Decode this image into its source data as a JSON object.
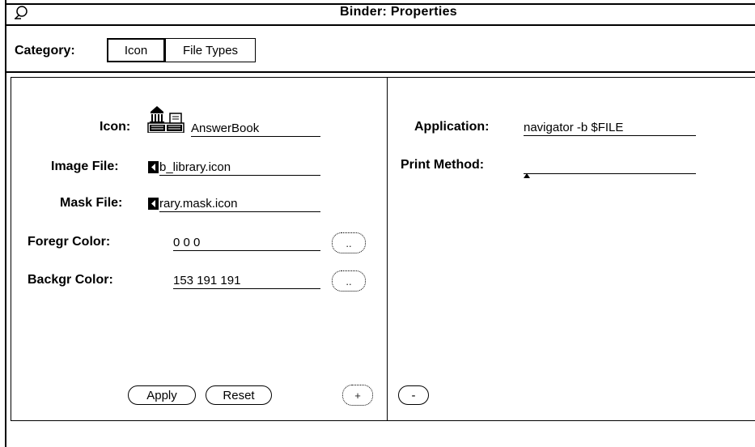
{
  "window": {
    "title": "Binder: Properties"
  },
  "category": {
    "label": "Category:",
    "options": [
      "Icon",
      "File Types"
    ],
    "selected": "Icon"
  },
  "left_panel": {
    "icon_label": "Icon:",
    "icon_name": "AnswerBook",
    "image_file_label": "Image File:",
    "image_file_value": "b_library.icon",
    "mask_file_label": "Mask File:",
    "mask_file_value": "rary.mask.icon",
    "foreground_label": "Foregr Color:",
    "foreground_value": "0 0 0",
    "background_label": "Backgr Color:",
    "background_value": "153 191 191",
    "color_chooser_glyph": "..",
    "apply_label": "Apply",
    "reset_label": "Reset",
    "add_glyph": "+"
  },
  "right_panel": {
    "application_label": "Application:",
    "application_value": "navigator -b $FILE",
    "print_method_label": "Print Method:",
    "print_method_value": "",
    "remove_glyph": "-"
  }
}
